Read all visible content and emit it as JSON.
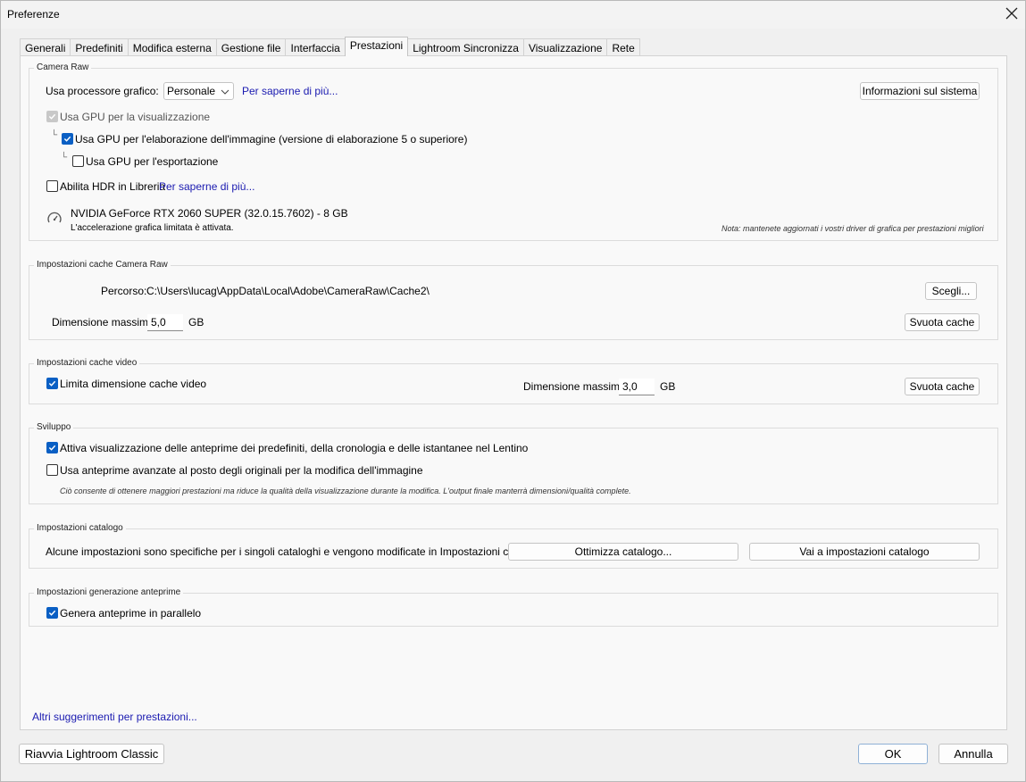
{
  "window": {
    "title": "Preferenze"
  },
  "tabs": [
    {
      "label": "Generali"
    },
    {
      "label": "Predefiniti"
    },
    {
      "label": "Modifica esterna"
    },
    {
      "label": "Gestione file"
    },
    {
      "label": "Interfaccia"
    },
    {
      "label": "Prestazioni",
      "active": true
    },
    {
      "label": "Lightroom Sincronizza"
    },
    {
      "label": "Visualizzazione"
    },
    {
      "label": "Rete"
    }
  ],
  "camera_raw": {
    "legend": "Camera Raw",
    "gpu_label": "Usa processore grafico:",
    "gpu_value": "Personale",
    "learn_more": "Per saperne di più...",
    "system_info_button": "Informazioni sul sistema",
    "gpu_display": "Usa GPU per la visualizzazione",
    "gpu_image_processing": "Usa GPU per l'elaborazione dell'immagine (versione di elaborazione 5 o superiore)",
    "gpu_export": "Usa GPU per l'esportazione",
    "hdr_library": "Abilita HDR in Libreria",
    "hdr_learn_more": "Per saperne di più...",
    "gpu_name": "NVIDIA GeForce RTX 2060 SUPER (32.0.15.7602) - 8 GB",
    "acceleration_status": "L'accelerazione grafica limitata è attivata.",
    "driver_note": "Nota: mantenete aggiornati i vostri driver di grafica per prestazioni migliori"
  },
  "cache_camera_raw": {
    "legend": "Impostazioni cache Camera Raw",
    "path_label": "Percorso:",
    "path_value": "C:\\Users\\lucag\\AppData\\Local\\Adobe\\CameraRaw\\Cache2\\",
    "choose_button": "Scegli...",
    "max_size_label": "Dimensione massima:",
    "max_size_value": "5,0",
    "unit": "GB",
    "purge_button": "Svuota cache"
  },
  "cache_video": {
    "legend": "Impostazioni cache video",
    "limit_label": "Limita dimensione cache video",
    "max_size_label": "Dimensione massima:",
    "max_size_value": "3,0",
    "unit": "GB",
    "purge_button": "Svuota cache"
  },
  "develop": {
    "legend": "Sviluppo",
    "enable_previews": "Attiva visualizzazione delle anteprime dei predefiniti, della cronologia e delle istantanee nel Lentino",
    "smart_previews": "Usa anteprime avanzate al posto degli originali per la modifica dell'immagine",
    "smart_previews_note": "Ciò consente di ottenere maggiori prestazioni ma riduce la qualità della visualizzazione durante la modifica. L'output finale manterrà dimensioni/qualità complete."
  },
  "catalog": {
    "legend": "Impostazioni catalogo",
    "description": "Alcune impostazioni sono specifiche per i singoli cataloghi e vengono modificate in Impostazioni catalogo.",
    "optimize_button": "Ottimizza catalogo...",
    "goto_settings_button": "Vai a impostazioni catalogo"
  },
  "previews": {
    "legend": "Impostazioni generazione anteprime",
    "parallel": "Genera anteprime in parallelo"
  },
  "more_tips_link": "Altri suggerimenti per prestazioni...",
  "footer": {
    "restart_button": "Riavvia Lightroom Classic",
    "ok_button": "OK",
    "cancel_button": "Annulla"
  }
}
